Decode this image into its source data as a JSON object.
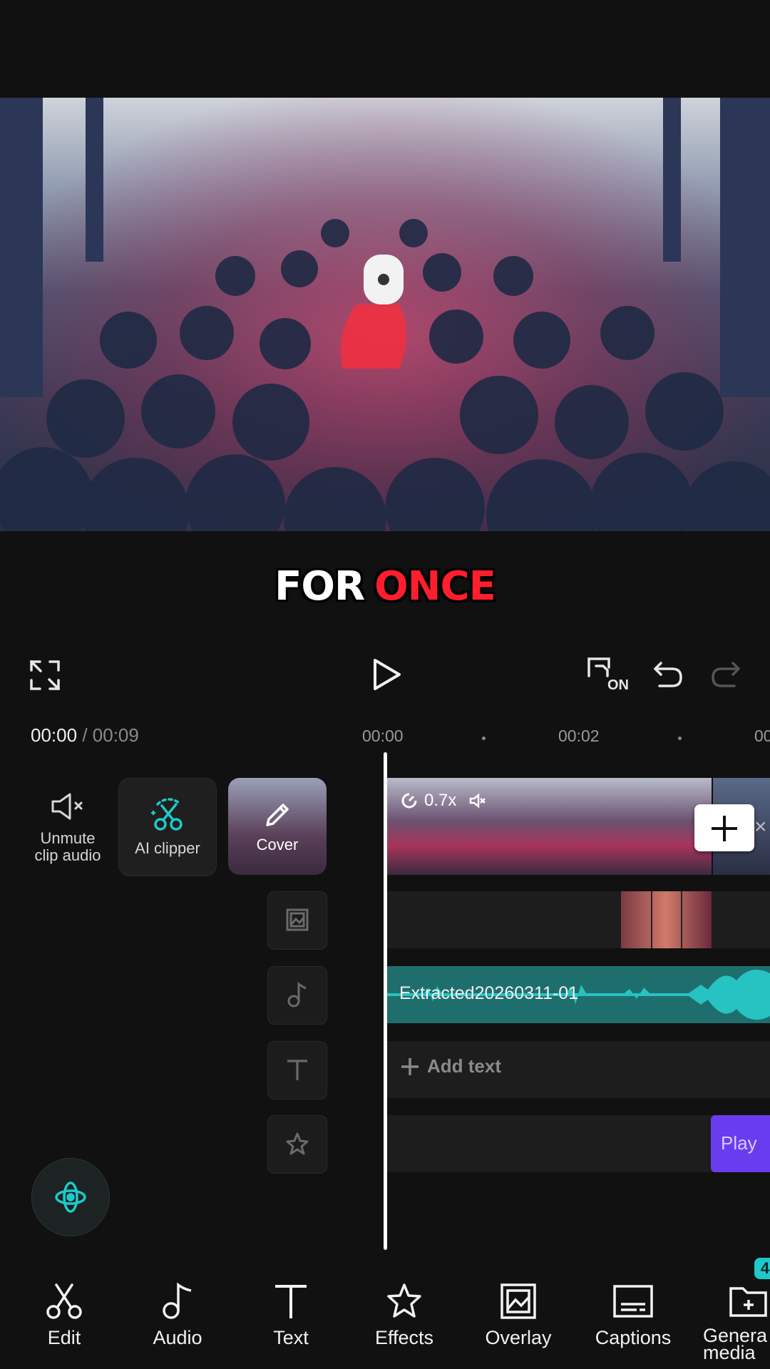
{
  "caption": {
    "word1": "FOR",
    "word2": "ONCE"
  },
  "playback": {
    "current": "00:00",
    "separator": "/",
    "total": "00:09"
  },
  "ruler": {
    "t0": "00:00",
    "t1": "00:02",
    "t2": "00:0"
  },
  "toolbar": {
    "hd_badge": "ON"
  },
  "left_tools": {
    "unmute_label": "Unmute\nclip audio",
    "ai_clipper_label": "AI clipper",
    "cover_label": "Cover"
  },
  "clip": {
    "speed": "0.7x"
  },
  "audio_track": {
    "name": "Extracted20260311-01"
  },
  "text_track": {
    "add_label": "Add text"
  },
  "effect_track": {
    "label": "Play"
  },
  "bottom_nav": {
    "items": [
      {
        "label": "Edit",
        "icon": "scissors-icon"
      },
      {
        "label": "Audio",
        "icon": "music-note-icon"
      },
      {
        "label": "Text",
        "icon": "text-icon"
      },
      {
        "label": "Effects",
        "icon": "effects-star-icon"
      },
      {
        "label": "Overlay",
        "icon": "overlay-image-icon"
      },
      {
        "label": "Captions",
        "icon": "captions-icon"
      },
      {
        "label": "Genera\nmedia",
        "icon": "generate-media-icon"
      }
    ],
    "badge": "4"
  },
  "colors": {
    "accent_teal": "#1fc9c9",
    "audio_track": "#1f6e6e",
    "effect_purple": "#6a3cf0",
    "caption_red": "#ff1e2d"
  }
}
